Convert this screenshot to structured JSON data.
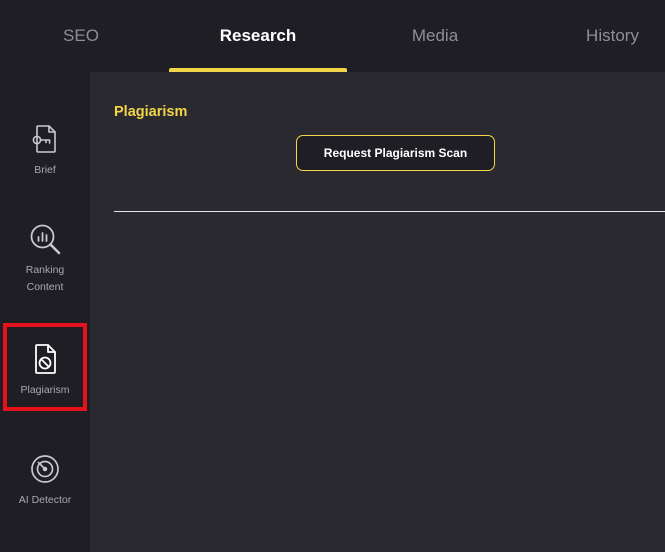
{
  "top_tabs": [
    {
      "label": "SEO",
      "active": false
    },
    {
      "label": "Research",
      "active": true
    },
    {
      "label": "Media",
      "active": false
    },
    {
      "label": "History",
      "active": false
    }
  ],
  "sidebar": {
    "items": [
      {
        "label": "Brief",
        "icon": "brief-icon"
      },
      {
        "label": "Ranking Content",
        "icon": "ranking-content-icon"
      },
      {
        "label": "Plagiarism",
        "icon": "plagiarism-icon",
        "selected": true
      },
      {
        "label": "AI Detector",
        "icon": "ai-detector-icon"
      }
    ]
  },
  "main": {
    "section_title": "Plagiarism",
    "scan_button_label": "Request Plagiarism Scan"
  },
  "colors": {
    "accent": "#f2d548",
    "background": "#1f1e24",
    "panel": "#2a2930",
    "highlight": "#e5121b"
  }
}
